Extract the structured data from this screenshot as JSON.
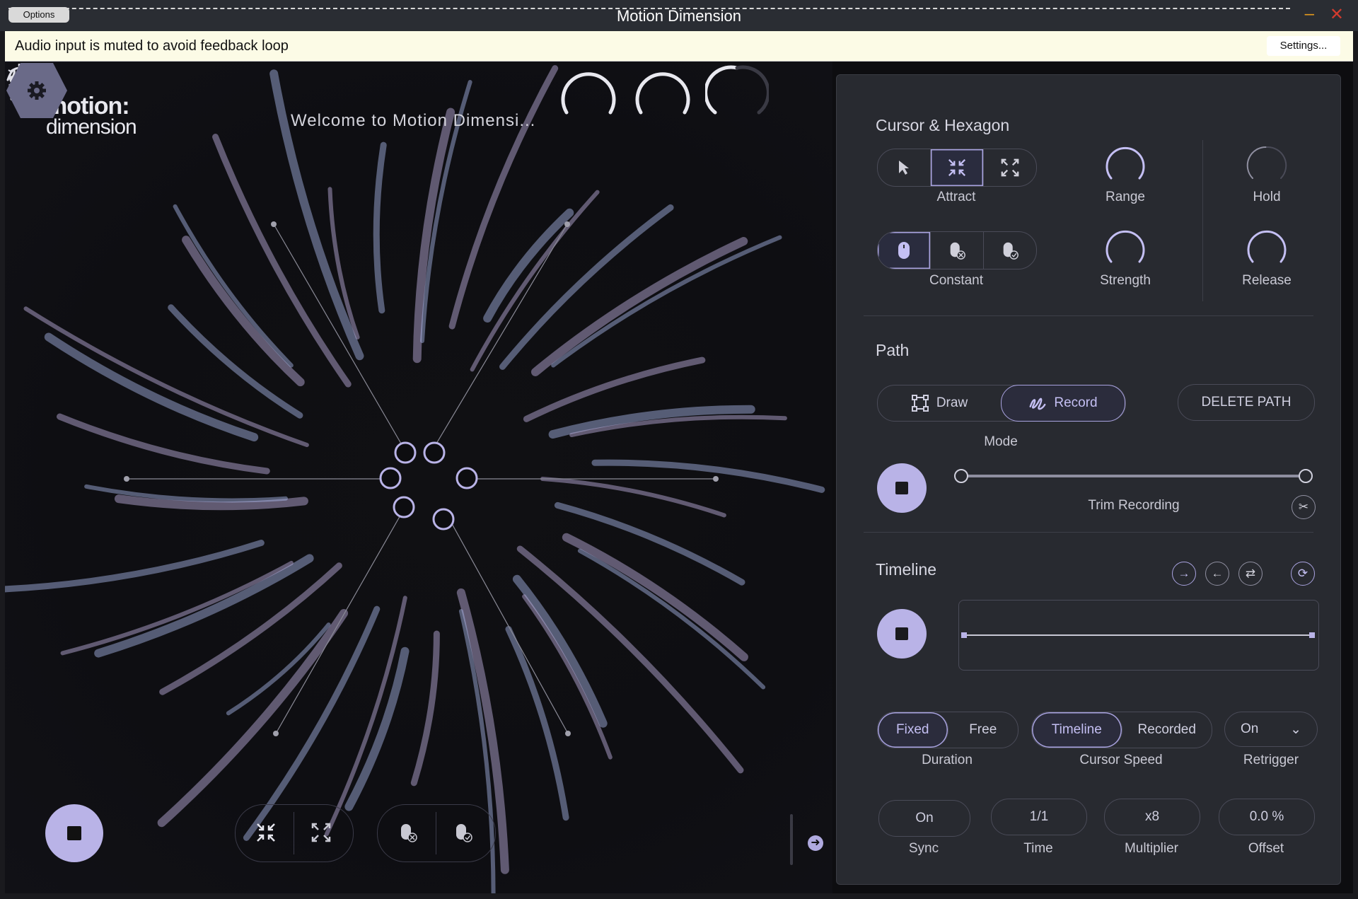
{
  "window": {
    "title": "Motion Dimension",
    "options_label": "Options",
    "minimize_glyph": "–",
    "close_glyph": "✕"
  },
  "notice": {
    "text": "Audio input is muted to avoid feedback loop",
    "settings_label": "Settings..."
  },
  "brand": {
    "line1": "motion:",
    "line2": "dimension"
  },
  "visualizer": {
    "welcome_text": "Welcome to Motion Dimensi..."
  },
  "cursor_hexagon": {
    "title": "Cursor & Hexagon",
    "cursor_mode_label": "Attract",
    "cursor_modes": [
      "pointer-icon",
      "attract-icon",
      "repel-icon"
    ],
    "selected_cursor_mode": "attract-icon",
    "click_mode_label": "Constant",
    "click_modes": [
      "mouse-icon",
      "mouse-x-icon",
      "mouse-check-icon"
    ],
    "selected_click_mode": "mouse-icon",
    "range_label": "Range",
    "strength_label": "Strength",
    "hold_label": "Hold",
    "release_label": "Release"
  },
  "path": {
    "title": "Path",
    "draw_label": "Draw",
    "record_label": "Record",
    "selected_mode": "Record",
    "delete_label": "DELETE PATH",
    "mode_label": "Mode",
    "trim_label": "Trim Recording"
  },
  "timeline": {
    "title": "Timeline",
    "duration": {
      "options": [
        "Fixed",
        "Free"
      ],
      "selected": "Fixed",
      "label": "Duration"
    },
    "cursor_speed": {
      "options": [
        "Timeline",
        "Recorded"
      ],
      "selected": "Timeline",
      "label": "Cursor Speed"
    },
    "retrigger": {
      "value": "On",
      "label": "Retrigger"
    },
    "sync": {
      "value": "On",
      "label": "Sync"
    },
    "time": {
      "value": "1/1",
      "label": "Time"
    },
    "multiplier": {
      "value": "x8",
      "label": "Multiplier"
    },
    "offset": {
      "value": "0.0 %",
      "label": "Offset"
    }
  },
  "colors": {
    "accent": "#b9b3e7",
    "panel_bg": "#282a30",
    "main_bg": "#0d0d10",
    "notice_bg": "#fcfbe6"
  }
}
